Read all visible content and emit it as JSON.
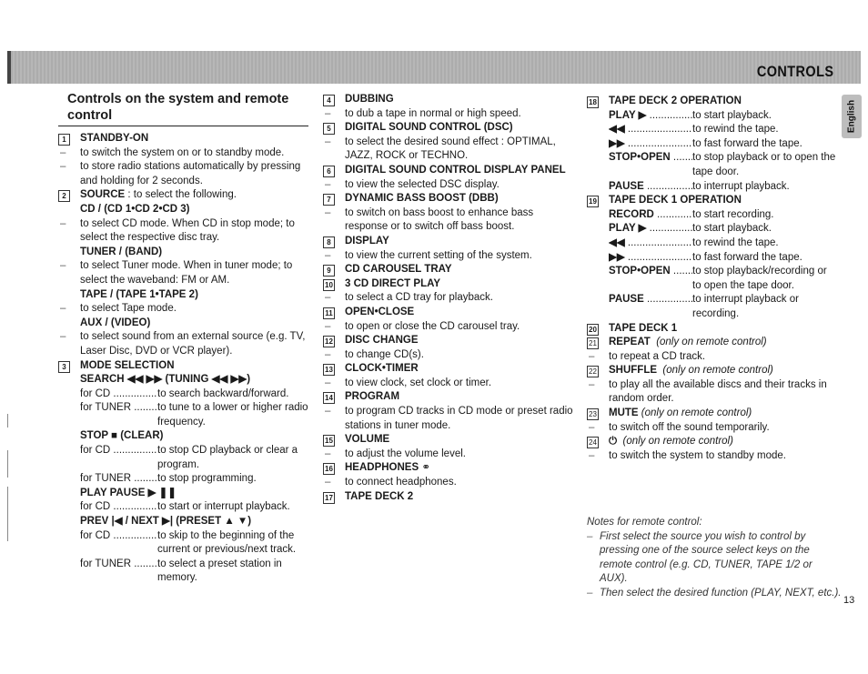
{
  "header": {
    "title": "CONTROLS",
    "language_tab": "English"
  },
  "section": {
    "heading": "Controls on the system and remote control"
  },
  "column1": {
    "item1": {
      "num": "1",
      "title": "STANDBY-ON",
      "desc": [
        "to switch the system on or to standby mode.",
        "to store radio stations automatically by pressing and holding for 2 seconds."
      ]
    },
    "item2": {
      "num": "2",
      "title": "SOURCE",
      "title_suffix": " : to select the following.",
      "cd": {
        "label": "CD / (CD 1•CD 2•CD 3)",
        "desc": "to select CD mode. When CD in stop mode; to select the respective disc tray."
      },
      "tuner": {
        "label": "TUNER / (BAND)",
        "desc": "to select Tuner mode. When in tuner mode; to select the waveband: FM or AM."
      },
      "tape": {
        "label": "TAPE / (TAPE 1•TAPE 2)",
        "desc": "to select Tape mode."
      },
      "aux": {
        "label": "AUX / (VIDEO)",
        "desc": "to select sound from an external source (e.g. TV, Laser Disc, DVD or VCR player)."
      }
    },
    "item3": {
      "num": "3",
      "title": "MODE SELECTION",
      "search": {
        "label": "SEARCH ◀◀ ▶▶ (TUNING ◀◀ ▶▶)",
        "rows": [
          {
            "k": "for CD",
            "v": "to search backward/forward."
          },
          {
            "k": "for TUNER",
            "v": "to tune to a lower or higher radio frequency."
          }
        ]
      },
      "stop": {
        "label": "STOP ■ (CLEAR)",
        "rows": [
          {
            "k": "for CD",
            "v": "to stop CD playback or clear a program."
          },
          {
            "k": "for TUNER",
            "v": "to stop programming."
          }
        ]
      },
      "playpause": {
        "label": "PLAY PAUSE ▶ ❚❚",
        "rows": [
          {
            "k": "for CD",
            "v": "to start or interrupt playback."
          }
        ]
      },
      "prevnext": {
        "label": "PREV |◀ / NEXT ▶| (PRESET ▲ ▼)",
        "rows": [
          {
            "k": "for CD",
            "v": "to skip to the beginning of the current or previous/next track."
          },
          {
            "k": "for TUNER",
            "v": "to select a preset station in memory."
          }
        ]
      }
    }
  },
  "column2": {
    "items": [
      {
        "num": "4",
        "title": "DUBBING",
        "desc": "to dub a tape in normal or high speed."
      },
      {
        "num": "5",
        "title": "DIGITAL SOUND CONTROL  (DSC)",
        "desc": "to select the desired sound effect : OPTIMAL, JAZZ, ROCK or TECHNO."
      },
      {
        "num": "6",
        "title": "DIGITAL SOUND CONTROL DISPLAY PANEL",
        "desc": "to view the selected DSC display."
      },
      {
        "num": "7",
        "title": "DYNAMIC BASS BOOST  (DBB)",
        "desc": "to switch on bass boost to enhance bass response or to switch off bass boost."
      },
      {
        "num": "8",
        "title": "DISPLAY",
        "desc": "to view the current setting of the system."
      },
      {
        "num": "9",
        "title": "CD CAROUSEL TRAY",
        "desc": null
      },
      {
        "num": "10",
        "title": "3 CD DIRECT PLAY",
        "desc": "to select a CD tray for playback."
      },
      {
        "num": "11",
        "title": "OPEN•CLOSE",
        "desc": "to open or close the CD carousel tray."
      },
      {
        "num": "12",
        "title": "DISC CHANGE",
        "desc": "to change CD(s)."
      },
      {
        "num": "13",
        "title": "CLOCK•TIMER",
        "desc": "to view clock, set clock or timer."
      },
      {
        "num": "14",
        "title": "PROGRAM",
        "desc": "to program CD tracks in CD mode or preset radio stations in tuner mode."
      },
      {
        "num": "15",
        "title": "VOLUME",
        "desc": "to adjust the volume level."
      },
      {
        "num": "16",
        "title": "HEADPHONES",
        "icon": "headphones-icon",
        "desc": "to connect headphones."
      },
      {
        "num": "17",
        "title": "TAPE DECK 2",
        "desc": null
      }
    ]
  },
  "column3": {
    "item18": {
      "num": "18",
      "title": "TAPE DECK 2 OPERATION",
      "rows": [
        {
          "k": "PLAY ▶",
          "v": "to start playback."
        },
        {
          "k": "◀◀",
          "v": "to rewind the tape."
        },
        {
          "k": "▶▶",
          "v": "to fast forward the tape."
        },
        {
          "k": "STOP•OPEN",
          "v": "to stop playback or to open the tape door."
        },
        {
          "k": "PAUSE",
          "v": "to interrupt playback."
        }
      ]
    },
    "item19": {
      "num": "19",
      "title": "TAPE DECK 1 OPERATION",
      "rows": [
        {
          "k": "RECORD",
          "v": "to start recording."
        },
        {
          "k": "PLAY ▶",
          "v": "to start playback."
        },
        {
          "k": "◀◀",
          "v": "to rewind the tape."
        },
        {
          "k": "▶▶",
          "v": "to fast forward the tape."
        },
        {
          "k": "STOP•OPEN",
          "v": "to stop playback/recording or to open the tape door."
        },
        {
          "k": "PAUSE",
          "v": "to interrupt playback or recording."
        }
      ]
    },
    "item20": {
      "num": "20",
      "title": "TAPE DECK 1"
    },
    "item21": {
      "num": "21",
      "title": "REPEAT",
      "note": "(only on remote control)",
      "desc": "to repeat a CD track."
    },
    "item22": {
      "num": "22",
      "title": "SHUFFLE",
      "note": "(only on remote control)",
      "desc": "to play all the available discs and their tracks in random order."
    },
    "item23": {
      "num": "23",
      "title": "MUTE",
      "note": "(only on remote control)",
      "desc": "to switch off the sound temporarily."
    },
    "item24": {
      "num": "24",
      "title": "⏻",
      "icon": "power-standby-icon",
      "note": "(only on remote control)",
      "desc": "to switch the system to standby mode."
    }
  },
  "notes": {
    "title": "Notes for remote control:",
    "items": [
      "First select the source you wish to control by pressing one of the source select keys on the remote control (e.g.  CD, TUNER, TAPE 1/2 or AUX).",
      "Then select the desired function (PLAY, NEXT, etc.)."
    ]
  },
  "page_number": "13"
}
